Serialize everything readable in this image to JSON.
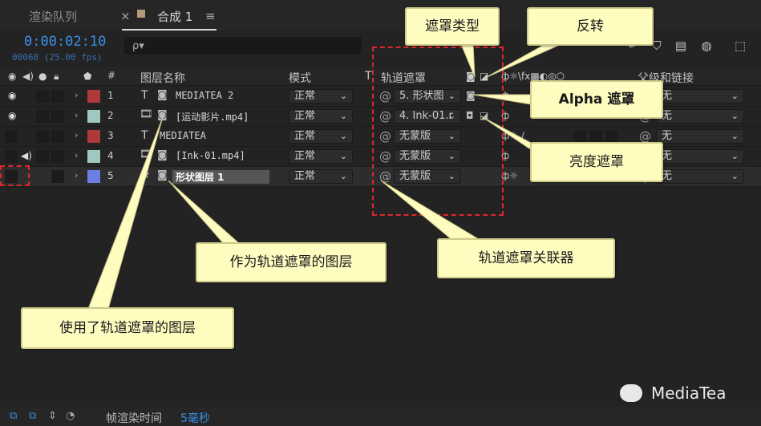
{
  "tabs": {
    "render_queue": "渲染队列",
    "close": "×",
    "comp": "合成 1",
    "menu": "≡"
  },
  "toolbar": {
    "timecode": "0:00:02:10",
    "frames": "00060 (25.00 fps)",
    "search_icon": "ρ▾"
  },
  "header": {
    "layer_name": "图层名称",
    "mode": "模式",
    "t": "T",
    "track_matte": "轨道遮罩",
    "parent": "父级和链接",
    "num": "#"
  },
  "layers": [
    {
      "num": "1",
      "name": "MEDIATEA 2",
      "type_icon": "T",
      "color": "#b03a3a",
      "mode": "正常",
      "matte": "5. 形状图",
      "parent": "无",
      "eye": "◉"
    },
    {
      "num": "2",
      "name": "[运动影片.mp4]",
      "type_icon": "🎞",
      "color": "#9fc9c0",
      "mode": "正常",
      "matte": "4. Ink-01.r",
      "parent": "无",
      "eye": "◉"
    },
    {
      "num": "3",
      "name": "MEDIATEA",
      "type_icon": "T",
      "color": "#b03a3a",
      "mode": "正常",
      "matte": "无蒙版",
      "parent": "无",
      "eye": ""
    },
    {
      "num": "4",
      "name": "[Ink-01.mp4]",
      "type_icon": "🎞",
      "color": "#9fc9c0",
      "mode": "正常",
      "matte": "无蒙版",
      "parent": "无",
      "eye": ""
    },
    {
      "num": "5",
      "name": "形状图层 1",
      "type_icon": "★",
      "color": "#6c7fe0",
      "mode": "正常",
      "matte": "无蒙版",
      "parent": "无",
      "eye": ""
    }
  ],
  "callouts": {
    "matte_type": "遮罩类型",
    "invert": "反转",
    "alpha": "Alpha 遮罩",
    "luma": "亮度遮罩",
    "as_matte": "作为轨道遮罩的图层",
    "linker": "轨道遮罩关联器",
    "using_matte": "使用了轨道遮罩的图层"
  },
  "bottom": {
    "render_time_label": "帧渲染时间",
    "render_time_value": "5毫秒"
  },
  "brand": {
    "name": "MediaTea"
  },
  "colors": {
    "accent": "#3a8ee6",
    "callout_bg": "#fffcc0",
    "dash": "#e3262b"
  }
}
